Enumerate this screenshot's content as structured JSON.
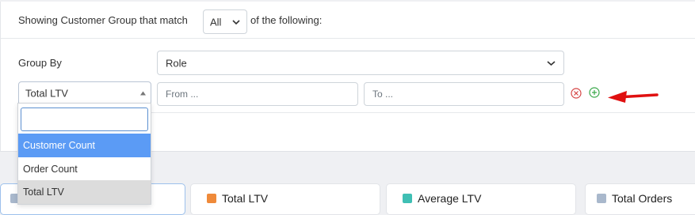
{
  "filter": {
    "prefix": "Showing Customer Group that match",
    "match_value": "All",
    "suffix": "of the following:",
    "group_by_label": "Group By",
    "group_by_value": "Role",
    "metric_value": "Total LTV",
    "from_placeholder": "From ...",
    "to_placeholder": "To ..."
  },
  "dropdown": {
    "search_value": "",
    "options": [
      {
        "label": "Customer Count",
        "state": "highlighted"
      },
      {
        "label": "Order Count",
        "state": "normal"
      },
      {
        "label": "Total LTV",
        "state": "selected"
      }
    ]
  },
  "cards": [
    {
      "label": "",
      "color": "#a9b8cc"
    },
    {
      "label": "Total LTV",
      "color": "#ef8a3a"
    },
    {
      "label": "Average LTV",
      "color": "#3fbfb4"
    },
    {
      "label": "Total Orders",
      "color": "#a9b8cc"
    }
  ],
  "colors": {
    "highlight": "#5b9bf5",
    "selected_bg": "#dcdcdc",
    "remove_icon": "#d64545",
    "add_icon": "#3aa84a",
    "arrow": "#e01010"
  }
}
